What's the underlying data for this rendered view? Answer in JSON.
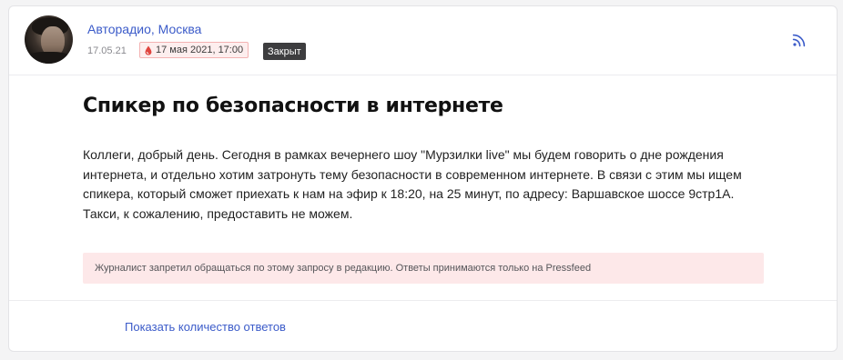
{
  "request": {
    "source_name": "Авторадио, Москва",
    "published_date": "17.05.21",
    "deadline": "17 мая 2021, 17:00",
    "status": "Закрыт",
    "title": "Спикер по безопасности в интернете",
    "body": "Коллеги, добрый день. Сегодня в рамках вечернего шоу \"Мурзилки live\" мы будем говорить о дне рождения интернета, и отдельно хотим затронуть тему безопасности в современном интернете. В связи с этим мы ищем спикера, который сможет приехать к нам на эфир к 18:20, на 25 минут, по адресу: Варшавское шоссе 9стр1А. Такси, к сожалению, предоставить не можем.",
    "notice": "Журналист запретил обращаться по этому запросу в редакцию. Ответы принимаются только на Pressfeed",
    "show_answers_label": "Показать количество ответов"
  },
  "icons": {
    "deadline": "drop-icon",
    "subscribe": "rss-icon",
    "author": "avatar"
  },
  "colors": {
    "link": "#3b5bc9",
    "status_badge_bg": "#3d3d3f",
    "deadline_border": "#f3b2b2",
    "deadline_bg": "#fdeeee",
    "notice_bg": "#fde8e9",
    "deadline_icon": "#e0443e"
  }
}
